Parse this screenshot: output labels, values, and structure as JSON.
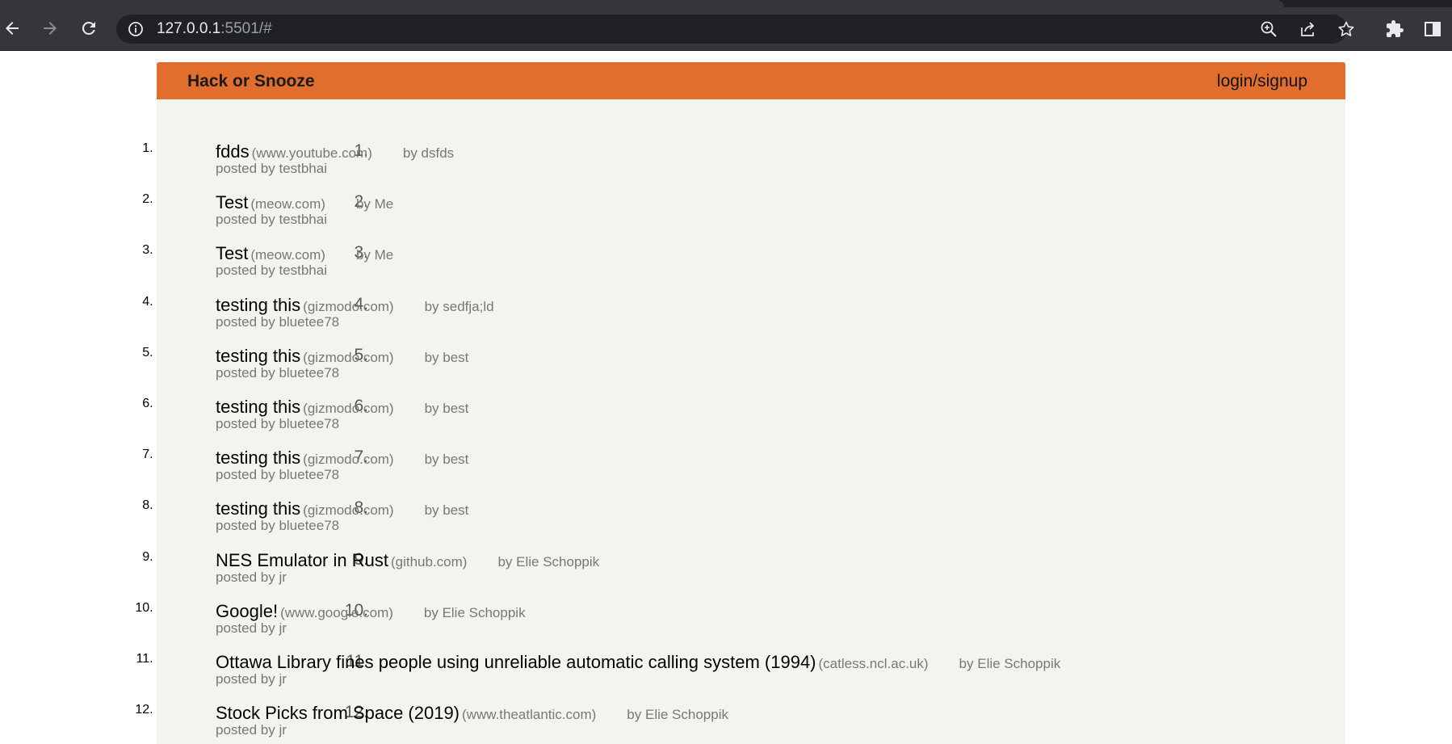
{
  "browser": {
    "url_host": "127.0.0.1",
    "url_rest": ":5501/#",
    "icons": [
      "back-arrow-icon",
      "forward-arrow-icon",
      "reload-icon",
      "info-icon",
      "zoom-icon",
      "share-icon",
      "star-icon",
      "puzzle-icon",
      "sidepanel-icon"
    ]
  },
  "header": {
    "brand": "Hack or Snooze",
    "login_label": "login/signup",
    "color": "#e26e2e"
  },
  "stories": [
    {
      "num": "1.",
      "title": "fdds",
      "host": "(www.youtube.com)",
      "author": "by dsfds",
      "poster": "posted by testbhai"
    },
    {
      "num": "2.",
      "title": "Test",
      "host": "(meow.com)",
      "author": "by Me",
      "poster": "posted by testbhai"
    },
    {
      "num": "3.",
      "title": "Test",
      "host": "(meow.com)",
      "author": "by Me",
      "poster": "posted by testbhai"
    },
    {
      "num": "4.",
      "title": "testing this",
      "host": "(gizmodo.com)",
      "author": "by sedfja;ld",
      "poster": "posted by bluetee78"
    },
    {
      "num": "5.",
      "title": "testing this",
      "host": "(gizmodo.com)",
      "author": "by best",
      "poster": "posted by bluetee78"
    },
    {
      "num": "6.",
      "title": "testing this",
      "host": "(gizmodo.com)",
      "author": "by best",
      "poster": "posted by bluetee78"
    },
    {
      "num": "7.",
      "title": "testing this",
      "host": "(gizmodo.com)",
      "author": "by best",
      "poster": "posted by bluetee78"
    },
    {
      "num": "8.",
      "title": "testing this",
      "host": "(gizmodo.com)",
      "author": "by best",
      "poster": "posted by bluetee78"
    },
    {
      "num": "9.",
      "title": "NES Emulator in Rust",
      "host": "(github.com)",
      "author": "by Elie Schoppik",
      "poster": "posted by jr"
    },
    {
      "num": "10.",
      "title": "Google!",
      "host": "(www.google.com)",
      "author": "by Elie Schoppik",
      "poster": "posted by jr"
    },
    {
      "num": "11.",
      "title": "Ottawa Library fines people using unreliable automatic calling system (1994)",
      "host": "(catless.ncl.ac.uk)",
      "author": "by Elie Schoppik",
      "poster": "posted by jr"
    },
    {
      "num": "12.",
      "title": "Stock Picks from Space (2019)",
      "host": "(www.theatlantic.com)",
      "author": "by Elie Schoppik",
      "poster": "posted by jr"
    }
  ]
}
